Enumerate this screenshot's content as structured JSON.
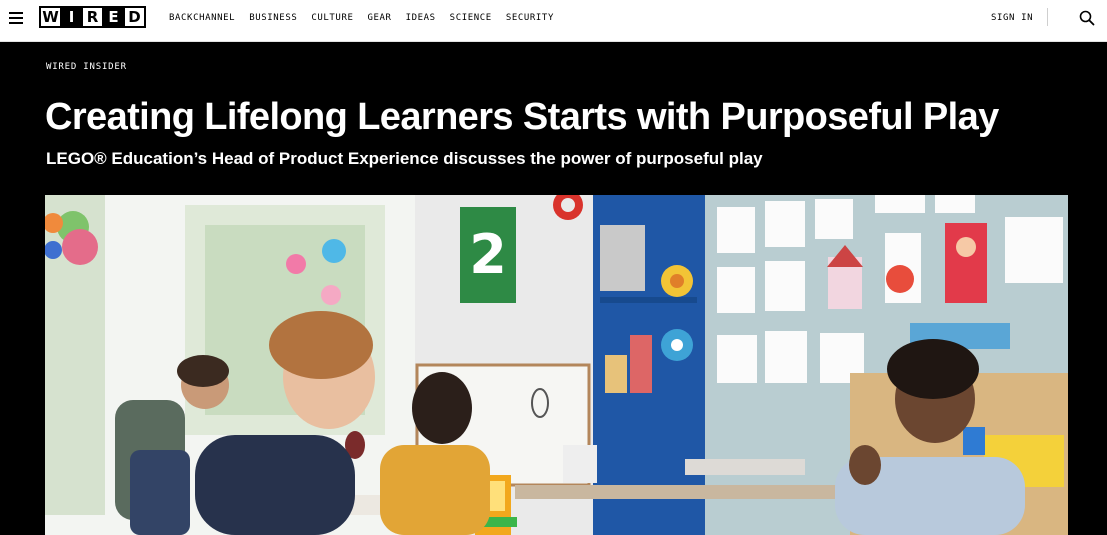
{
  "header": {
    "menu_icon": "hamburger-menu-icon",
    "logo_letters": [
      "W",
      "I",
      "R",
      "E",
      "D"
    ],
    "nav": [
      "BACKCHANNEL",
      "BUSINESS",
      "CULTURE",
      "GEAR",
      "IDEAS",
      "SCIENCE",
      "SECURITY"
    ],
    "sign_in": "SIGN IN",
    "search_icon": "search-icon"
  },
  "article": {
    "kicker": "WIRED INSIDER",
    "headline": "Creating Lifelong Learners Starts with Purposeful Play",
    "dek": "LEGO® Education’s Head of Product Experience discusses the power of purposeful play"
  },
  "colors": {
    "nav_bg": "#ffffff",
    "page_bg": "#000000",
    "text_on_dark": "#ffffff"
  }
}
